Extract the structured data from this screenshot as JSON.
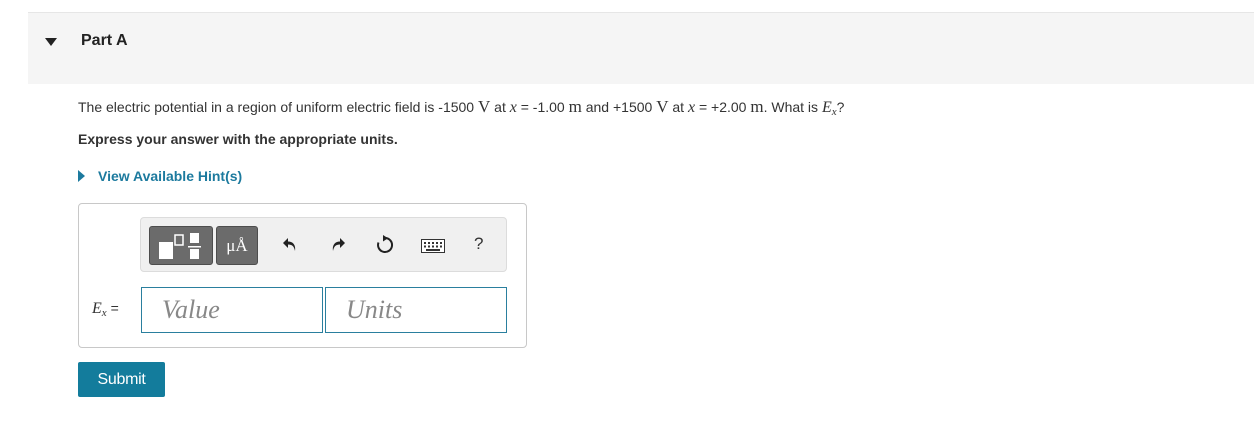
{
  "part": {
    "title": "Part A"
  },
  "question": {
    "t1": "The electric potential in a region of uniform electric field is -1500 ",
    "u1": "V",
    "t2": " at ",
    "var1": "x",
    "t3": " = -1.00 ",
    "u2": "m",
    "t4": " and +1500 ",
    "u3": "V",
    "t5": " at ",
    "var2": "x",
    "t6": " = +2.00 ",
    "u4": "m",
    "t7": ". What is ",
    "e_sym": "E",
    "e_sub": "x",
    "t8": "?"
  },
  "instruction": "Express your answer with the appropriate units.",
  "hint_link": "View Available Hint(s)",
  "toolbar": {
    "units_button": "μÅ",
    "help_label": "?"
  },
  "answer": {
    "var_symbol": "E",
    "var_sub": "x",
    "equals": "=",
    "value_placeholder": "Value",
    "units_placeholder": "Units"
  },
  "submit_label": "Submit",
  "colors": {
    "link": "#1c7a9e",
    "submit_bg": "#137c9c",
    "header_bg": "#f5f5f5"
  },
  "icons": [
    "collapse-triangle-icon",
    "templates-icon",
    "undo-icon",
    "redo-icon",
    "reset-icon",
    "keyboard-icon"
  ]
}
